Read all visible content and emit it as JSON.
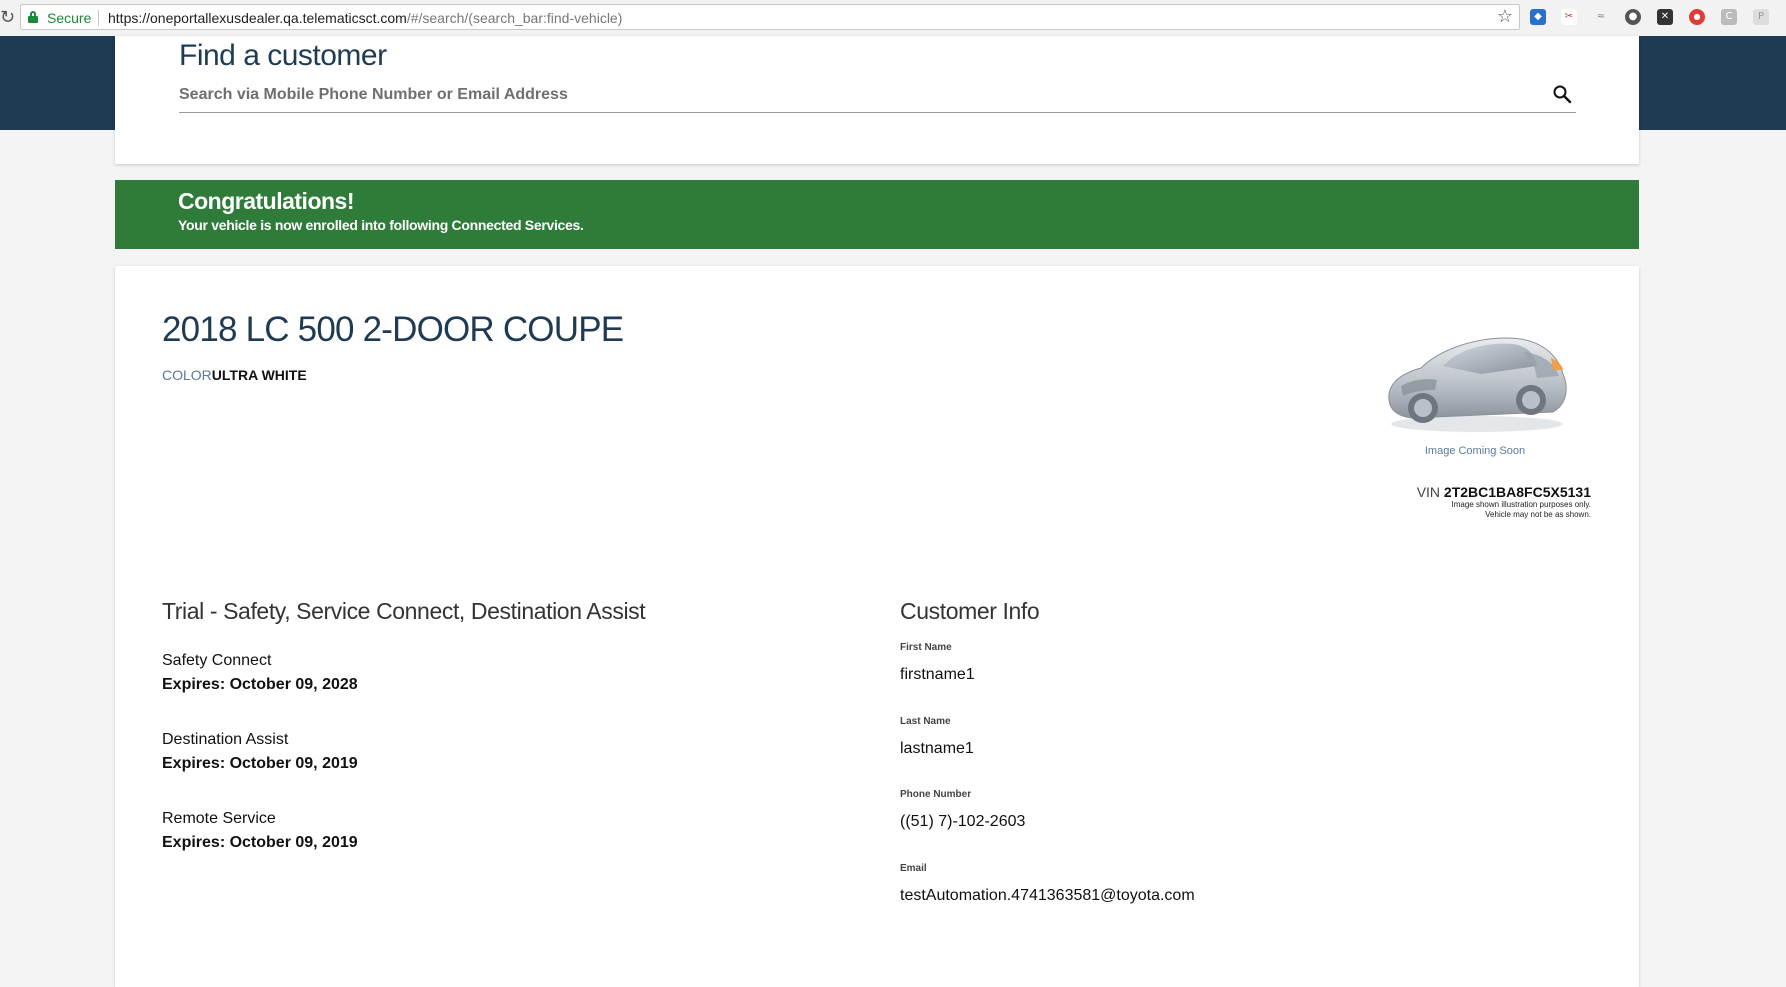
{
  "browser": {
    "secure_label": "Secure",
    "url_host": "https://oneportallexusdealer.qa.telematicsct.com",
    "url_path": "/#/search/(search_bar:find-vehicle)"
  },
  "search": {
    "title": "Find a customer",
    "placeholder": "Search via Mobile Phone Number or Email Address",
    "value": ""
  },
  "banner": {
    "title": "Congratulations!",
    "subtitle": "Your vehicle is now enrolled into following Connected Services.",
    "color": "#2f7b3a"
  },
  "vehicle": {
    "name": "2018 LC 500 2-DOOR COUPE",
    "color_label": "COLOR",
    "color_value": "ULTRA WHITE",
    "image_caption": "Image Coming Soon",
    "vin_label": "VIN",
    "vin_value": "2T2BC1BA8FC5X5131",
    "disclaimer_line1": "Image shown illustration purposes only.",
    "disclaimer_line2": "Vehicle may not be as shown."
  },
  "services": {
    "plan_title": "Trial - Safety, Service Connect, Destination Assist",
    "items": [
      {
        "name": "Safety Connect",
        "expires": "Expires: October 09, 2028"
      },
      {
        "name": "Destination Assist",
        "expires": "Expires: October 09, 2019"
      },
      {
        "name": "Remote Service",
        "expires": "Expires: October 09, 2019"
      }
    ]
  },
  "customer": {
    "title": "Customer Info",
    "fields": [
      {
        "label": "First Name",
        "value": "firstname1"
      },
      {
        "label": "Last Name",
        "value": "lastname1"
      },
      {
        "label": "Phone Number",
        "value": "((51) 7)-102-2603"
      },
      {
        "label": "Email",
        "value": "testAutomation.4741363581@toyota.com"
      }
    ]
  },
  "colors": {
    "brand_navy": "#1f3b54",
    "success_green": "#2f7b3a",
    "secure_green": "#1b8a3a"
  }
}
